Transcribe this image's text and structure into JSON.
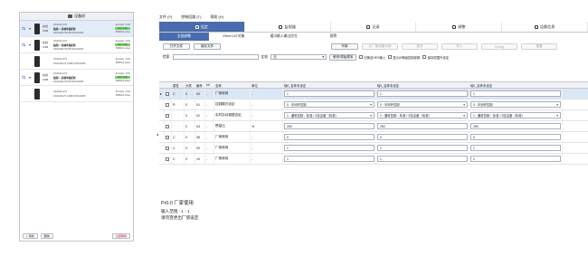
{
  "left_panel": {
    "title": "设备树",
    "devices": [
      {
        "selected": true,
        "status": "在线",
        "port": "USB",
        "model": "HS3442-H70",
        "name": "轴组1 : 机械单轴控制",
        "serial": "HS3442H70USB 000102305",
        "fw": "Encoder: 23%",
        "mode": "B386A4 pulse",
        "badge": "SRV OFF"
      },
      {
        "selected": false,
        "status": "在线",
        "port": "USB",
        "model": "HS3442-H70",
        "name": "轴组1 : 机械单轴控制",
        "serial": "HS3442H70USB 000102305",
        "fw": "Encoder: 23%",
        "mode": "B386A4 pulse",
        "badge": "SRV OFF"
      },
      {
        "selected": false,
        "status": "",
        "port": "",
        "model": "HS3442-H70",
        "name": "",
        "serial": "HS3442H70 (USB) 000102305",
        "fw": "Encoder: 23%",
        "mode": "B386A4 pulse",
        "badge": ""
      },
      {
        "selected": false,
        "status": "在线",
        "port": "USB",
        "model": "HS3442-H70",
        "name": "轴组1 : 机械单轴控制",
        "serial": "HS3442H70USB 000102305",
        "fw": "Encoder: 23%",
        "mode": "B386A4 pulse",
        "badge": "SRV OFF"
      },
      {
        "selected": false,
        "status": "",
        "port": "",
        "model": "HS3442-H70",
        "name": "",
        "serial": "HS3442H70 (USB) 000102305",
        "fw": "Encoder: 23%",
        "mode": "B386A4 pulse",
        "badge": ""
      }
    ],
    "footer": {
      "add": "+ 添加",
      "delete": "删除",
      "remove_all": "全部删除"
    }
  },
  "menu": [
    "文件 (F)",
    "控制回路 (T)",
    "帮助 (H)"
  ],
  "tabs": [
    "设定",
    "监视器",
    "记录",
    "调整",
    "设备信息"
  ],
  "active_tab": 0,
  "subtabs": [
    "全部参数",
    "EtherCAT对象",
    "通讯输入输出信号",
    "报警"
  ],
  "active_subtab": 0,
  "toolbar": {
    "open": "打开文件",
    "save": "保存文件",
    "write": "写新",
    "upload": "从厂家设备写新",
    "compare": "差异",
    "import": "导入",
    "config": "Config",
    "reset": "重置"
  },
  "filter": {
    "search_label": "检索",
    "search_value": "",
    "compare_label": "比较",
    "compare_value": "无",
    "initial_button": "差别/原始顺序",
    "chk_hex": "切换至HEX输入",
    "chk_ai": "显示AI等级控制参数",
    "chk_range": "保持范围外设定"
  },
  "grid": {
    "headers": [
      "",
      "",
      "属性",
      "分类",
      "编号",
      "bit",
      "名称",
      "单位",
      "轴0_名称未设定",
      "轴1_名称未设定",
      "轴2_名称未设定"
    ],
    "rows": [
      {
        "sel": true,
        "attr": "C",
        "cat": "0",
        "no": "00",
        "bit": "-",
        "name": "厂家使用",
        "unit": "-",
        "v0": "1",
        "v1": "1",
        "v2": "1",
        "type": "text"
      },
      {
        "sel": false,
        "attr": "R",
        "cat": "0",
        "no": "01",
        "bit": "-",
        "name": "控制模式设定",
        "unit": "-",
        "v0": "0 : 半闭环控制",
        "v1": "0 : 半闭环控制",
        "v2": "0 : 半闭环控制",
        "type": "dd"
      },
      {
        "sel": false,
        "attr": "",
        "cat": "0",
        "no": "02",
        "bit": "-",
        "name": "实时自动调整设定",
        "unit": "-",
        "v0": "1 : 通常控制：标准 / 2自由度（标准）",
        "v1": "1 : 通常控制：标准 / 2自由度（标准）",
        "v2": "1 : 通常控制：标准 / 2自由度（标准）",
        "type": "dd"
      },
      {
        "sel": false,
        "attr": "",
        "cat": "0",
        "no": "04",
        "bit": "-",
        "name": "惯量比",
        "unit": "%",
        "v0": "250",
        "v1": "250",
        "v2": "250",
        "type": "text"
      },
      {
        "sel": false,
        "attr": "C",
        "cat": "0",
        "no": "08",
        "bit": "-",
        "name": "厂家使用",
        "unit": "-",
        "v0": "0",
        "v1": "0",
        "v2": "0",
        "type": "text"
      },
      {
        "sel": false,
        "attr": "C",
        "cat": "0",
        "no": "09",
        "bit": "-",
        "name": "厂家使用",
        "unit": "-",
        "v0": "1",
        "v1": "1",
        "v2": "1",
        "type": "text"
      },
      {
        "sel": false,
        "attr": "C",
        "cat": "0",
        "no": "10",
        "bit": "-",
        "name": "厂家使用",
        "unit": "-",
        "v0": "1",
        "v1": "1",
        "v2": "1",
        "type": "text"
      }
    ]
  },
  "description": {
    "title": "Pr0.0 厂家使用",
    "range": "输入范围 : 1 - 1",
    "note": "请勿变更出厂值设定"
  }
}
